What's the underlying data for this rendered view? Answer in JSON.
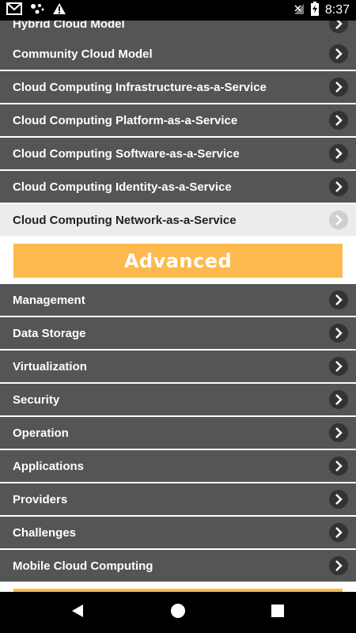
{
  "status_bar": {
    "time": "8:37",
    "left_icons": [
      "gmail-icon",
      "assistant-dots-icon",
      "warning-icon"
    ],
    "right_icons": [
      "signal-off-icon",
      "battery-charging-icon"
    ]
  },
  "cloud_models": [
    {
      "label": "Hybrid Cloud Model"
    },
    {
      "label": "Community Cloud Model"
    },
    {
      "label": "Cloud Computing Infrastructure-as-a-Service"
    },
    {
      "label": "Cloud Computing Platform-as-a-Service"
    },
    {
      "label": "Cloud Computing Software-as-a-Service"
    },
    {
      "label": "Cloud Computing Identity-as-a-Service"
    },
    {
      "label": "Cloud Computing Network-as-a-Service",
      "selected": true
    }
  ],
  "advanced_section": {
    "title": "Advanced",
    "items": [
      {
        "label": "Management"
      },
      {
        "label": "Data Storage"
      },
      {
        "label": "Virtualization"
      },
      {
        "label": "Security"
      },
      {
        "label": "Operation"
      },
      {
        "label": "Applications"
      },
      {
        "label": "Providers"
      },
      {
        "label": "Challenges"
      },
      {
        "label": "Mobile Cloud Computing"
      }
    ]
  },
  "colors": {
    "row_bg": "#555555",
    "selected_bg": "#ececec",
    "accent": "#fdb94d"
  },
  "nav_bar": {
    "buttons": [
      "back-icon",
      "home-icon",
      "recents-icon"
    ]
  }
}
